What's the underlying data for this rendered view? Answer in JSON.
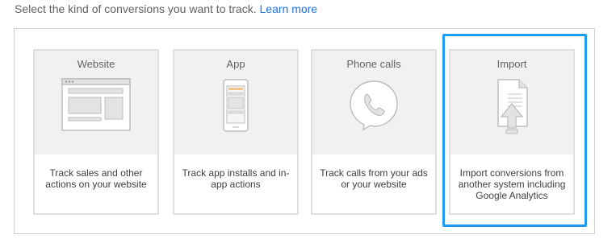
{
  "intro": {
    "text": "Select the kind of conversions you want to track.",
    "link": "Learn more"
  },
  "cards": [
    {
      "title": "Website",
      "icon": "website-icon",
      "description": "Track sales and other actions on your website"
    },
    {
      "title": "App",
      "icon": "mobile-app-icon",
      "description": "Track app installs and in-app actions"
    },
    {
      "title": "Phone calls",
      "icon": "phone-call-icon",
      "description": "Track calls from your ads or your website"
    },
    {
      "title": "Import",
      "icon": "import-file-icon",
      "description": "Import conversions from another system including Google Analytics"
    }
  ],
  "colors": {
    "highlight": "#1b9af7",
    "link": "#1a73e8",
    "card_border": "#e0e0e0",
    "card_top_bg": "#f1f1f1"
  },
  "selected_card": "Import"
}
